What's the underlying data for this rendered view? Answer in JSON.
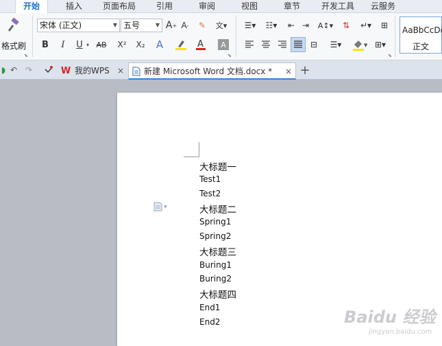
{
  "menu": {
    "tabs": [
      "开始",
      "插入",
      "页面布局",
      "引用",
      "审阅",
      "视图",
      "章节",
      "开发工具",
      "云服务"
    ],
    "active_index": 0
  },
  "ribbon": {
    "format_painter_label": "格式刷",
    "font_name": "宋体 (正文)",
    "font_size": "五号",
    "bold": "B",
    "italic": "I",
    "underline": "U",
    "strike": "AB",
    "superscript": "X²",
    "subscript": "X₂",
    "font_color_letter": "A",
    "style_sample": "AaBbCcDd",
    "style_name": "正文"
  },
  "tabbar": {
    "tabs": [
      {
        "label": "我的WPS"
      },
      {
        "label": "新建 Microsoft Word 文档.docx *"
      }
    ],
    "close_symbol": "×",
    "new_tab_symbol": "+"
  },
  "document": {
    "lines": [
      {
        "text": "大标题一",
        "kind": "heading"
      },
      {
        "text": "Test1",
        "kind": "body"
      },
      {
        "text": "Test2",
        "kind": "body"
      },
      {
        "text": "大标题二",
        "kind": "heading"
      },
      {
        "text": "Spring1",
        "kind": "body"
      },
      {
        "text": "Spring2",
        "kind": "body"
      },
      {
        "text": "大标题三",
        "kind": "heading"
      },
      {
        "text": "Buring1",
        "kind": "body"
      },
      {
        "text": "Buring2",
        "kind": "body"
      },
      {
        "text": "大标题四",
        "kind": "heading"
      },
      {
        "text": "End1",
        "kind": "body"
      },
      {
        "text": "End2",
        "kind": "body"
      }
    ]
  },
  "watermark": {
    "brand": "Baidu 经验",
    "url": "jingyan.baidu.com"
  },
  "colors": {
    "accent": "#1f6fd1",
    "wps_red": "#d9252a",
    "highlight_yellow": "#f5e400",
    "font_red": "#e02020"
  }
}
